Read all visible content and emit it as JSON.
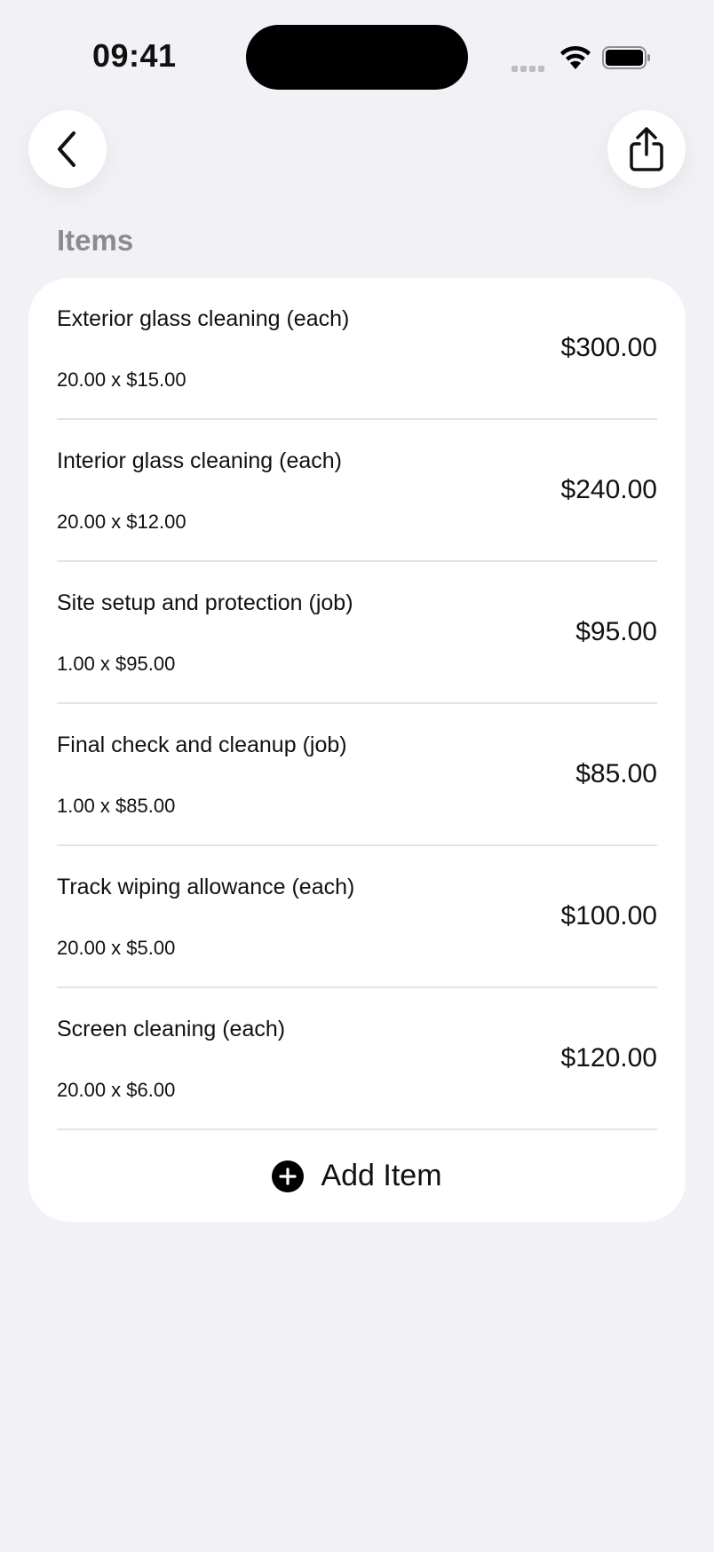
{
  "status_bar": {
    "time": "09:41"
  },
  "section": {
    "title": "Items"
  },
  "items": [
    {
      "name": "Exterior glass cleaning (each)",
      "detail": "20.00 x $15.00",
      "total": "$300.00"
    },
    {
      "name": "Interior glass cleaning (each)",
      "detail": "20.00 x $12.00",
      "total": "$240.00"
    },
    {
      "name": "Site setup and protection (job)",
      "detail": "1.00 x $95.00",
      "total": "$95.00"
    },
    {
      "name": "Final check and cleanup (job)",
      "detail": "1.00 x $85.00",
      "total": "$85.00"
    },
    {
      "name": "Track wiping allowance (each)",
      "detail": "20.00 x $5.00",
      "total": "$100.00"
    },
    {
      "name": "Screen cleaning (each)",
      "detail": "20.00 x $6.00",
      "total": "$120.00"
    }
  ],
  "actions": {
    "add_item_label": "Add Item"
  },
  "icons": {
    "back": "chevron-left-icon",
    "share": "share-icon",
    "add": "plus-circle-icon"
  },
  "colors": {
    "background": "#f1f1f6",
    "card": "#ffffff",
    "section_title": "#8b8b91"
  }
}
